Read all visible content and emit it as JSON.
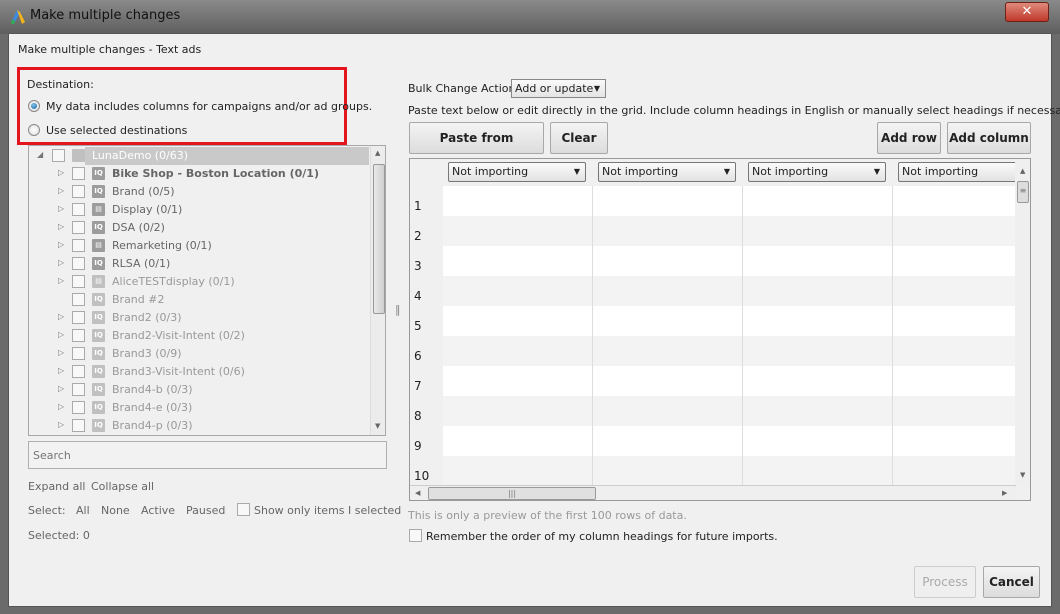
{
  "window": {
    "title": "Make multiple changes",
    "close_icon": "close-icon"
  },
  "subtitle": "Make multiple changes - Text ads",
  "destination": {
    "label": "Destination:",
    "options": [
      {
        "label": "My data includes columns for campaigns and/or ad groups.",
        "selected": true
      },
      {
        "label": "Use selected destinations",
        "selected": false
      }
    ],
    "highlight_color": "#e3141e"
  },
  "tree": {
    "root": {
      "label": "LunaDemo (0/63)"
    },
    "items": [
      {
        "label": "Bike Shop - Boston Location (0/1)",
        "icon": "search-campaign-icon",
        "bold": true,
        "expandable": true
      },
      {
        "label": "Brand (0/5)",
        "icon": "search-campaign-icon",
        "expandable": true
      },
      {
        "label": "Display (0/1)",
        "icon": "display-campaign-icon",
        "expandable": true
      },
      {
        "label": "DSA (0/2)",
        "icon": "search-campaign-icon",
        "expandable": true
      },
      {
        "label": "Remarketing (0/1)",
        "icon": "display-campaign-icon",
        "expandable": true
      },
      {
        "label": "RLSA (0/1)",
        "icon": "search-campaign-icon",
        "expandable": true
      },
      {
        "label": "AliceTESTdisplay (0/1)",
        "icon": "display-campaign-icon",
        "expandable": true,
        "dim": true
      },
      {
        "label": "Brand #2",
        "icon": "search-campaign-icon",
        "expandable": false,
        "dim": true
      },
      {
        "label": "Brand2 (0/3)",
        "icon": "search-campaign-icon",
        "expandable": true,
        "dim": true
      },
      {
        "label": "Brand2-Visit-Intent (0/2)",
        "icon": "search-campaign-icon",
        "expandable": true,
        "dim": true
      },
      {
        "label": "Brand3 (0/9)",
        "icon": "search-campaign-icon",
        "expandable": true,
        "dim": true
      },
      {
        "label": "Brand3-Visit-Intent (0/6)",
        "icon": "search-campaign-icon",
        "expandable": true,
        "dim": true
      },
      {
        "label": "Brand4-b (0/3)",
        "icon": "search-campaign-icon",
        "expandable": true,
        "dim": true
      },
      {
        "label": "Brand4-e (0/3)",
        "icon": "search-campaign-icon",
        "expandable": true,
        "dim": true
      },
      {
        "label": "Brand4-p (0/3)",
        "icon": "search-campaign-icon",
        "expandable": true,
        "dim": true
      }
    ]
  },
  "search": {
    "placeholder": "Search"
  },
  "links": {
    "expand_all": "Expand all",
    "collapse_all": "Collapse all"
  },
  "select": {
    "label": "Select:",
    "all": "All",
    "none": "None",
    "active": "Active",
    "paused": "Paused",
    "show_only": "Show only items I selected"
  },
  "selected_count": "Selected: 0",
  "bulk": {
    "label": "Bulk Change Action:",
    "value": "Add or update"
  },
  "instructions": "Paste text below or edit directly in the grid. Include column headings in English or manually select headings if necessary.",
  "buttons": {
    "paste": "Paste from clipboard",
    "clear": "Clear",
    "add_row": "Add row",
    "add_column": "Add column",
    "process": "Process",
    "cancel": "Cancel"
  },
  "grid": {
    "headers": [
      "Not importing",
      "Not importing",
      "Not importing",
      "Not importing"
    ],
    "rows": [
      "1",
      "2",
      "3",
      "4",
      "5",
      "6",
      "7",
      "8",
      "9",
      "10"
    ]
  },
  "preview_note": "This is only a preview of the first 100 rows of data.",
  "remember": {
    "label": "Remember the order of my column headings for future imports.",
    "checked": false
  }
}
